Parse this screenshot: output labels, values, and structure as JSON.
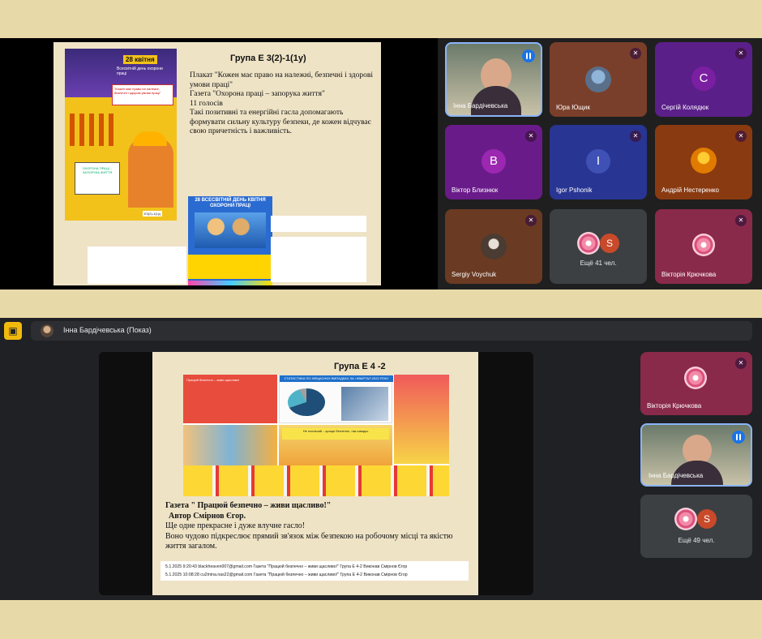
{
  "colors": {
    "accent": "#1a73e8",
    "background": "#e8d9a8",
    "panel": "#202124"
  },
  "screen1": {
    "slide": {
      "title": "Група Е 3(2)-1(1у)",
      "lines": [
        "Плакат \"Кожен має право на належні, безпечні і здорові умови праці\"",
        "Газета \"Охорона праці – запорука життя\"",
        "11 голосів",
        "Такі позитивні та енергійні гасла допомагають формувати сильну культуру безпеки, де кожен відчуває свою причетність і важливість."
      ],
      "poster_left": {
        "date": "28 квітня",
        "subtitle": "Всесвітній день охорони праці",
        "quote": "\"Кожен має право на належні, безпечні і здорові умови праці\"",
        "box": "ОХОРОНА ПРАЦІ – ЗАПОРУКА ЖИТТЯ",
        "code": "Е3(2)-1(1у)"
      },
      "poster_mid": {
        "title": "28 ВСЕСВІТНІЙ ДЕНЬ КВІТНЯ ОХОРОНИ ПРАЦІ"
      }
    },
    "participants": [
      {
        "name": "Інна Бардічевська",
        "kind": "video",
        "speaking": true
      },
      {
        "name": "Юра Ющик",
        "kind": "photo",
        "muted": true
      },
      {
        "name": "Сергій Колядюк",
        "kind": "letter",
        "letter": "C",
        "color": "#7b1fa2",
        "muted": true
      },
      {
        "name": "Віктор Близнюк",
        "kind": "letter",
        "letter": "B",
        "color": "#8e24aa",
        "muted": true
      },
      {
        "name": "Igor Pshonik",
        "kind": "letter",
        "letter": "I",
        "color": "#3949ab",
        "muted": true
      },
      {
        "name": "Андрій Нестеренко",
        "kind": "photo",
        "muted": true
      },
      {
        "name": "Sergiy Voychuk",
        "kind": "photo",
        "muted": true
      },
      {
        "name": "",
        "kind": "more",
        "more_label": "Ещё 41 чел.",
        "letter": "S"
      },
      {
        "name": "Вікторія Крючкова",
        "kind": "flower",
        "muted": true
      }
    ]
  },
  "screen2": {
    "presenter_bar": {
      "title": "Інна Бардічевська (Показ)"
    },
    "slide": {
      "title": "Група Е 4 -2",
      "bold_lines": [
        "Газета \" Працюй безпечно – живи щасливо!\"",
        "Автор Смірнов Єгор."
      ],
      "lines": [
        "Ще одне прекрасне і дуже влучне гасло!",
        "Воно чудово підкреслює прямий зв'язок між безпекою на робочому місці та якістю життя загалом."
      ],
      "table_rows": [
        "5.1.2025 9:20:43  blackheaven007@gmail.com    Газета \"Працюй безпечно – живи щасливо!\" Група Е 4-2 Виконав Смірнов Єгор",
        "5.1.2025 10:08:28  cu2mina.nas22@gmail.com    Газета \"Працюй безпечно – живи щасливо!\" Група Е 4-2 Виконав Смірнов Єгор"
      ],
      "collage_red": "Працюй безпечно – живи щасливо!",
      "collage_stat": "СТАТИСТИКА ПО НЕЩАСНИХ ВИПАДКАХ ЗА І КВАРТАЛ 2022 РОКУ",
      "collage_yellow": "Не поспішай – краще безпечно, ніж швидко"
    },
    "participants": [
      {
        "name": "Вікторія Крючкова",
        "kind": "flower",
        "muted": true
      },
      {
        "name": "Інна Бардічевська",
        "kind": "video",
        "speaking": true
      },
      {
        "name": "",
        "kind": "more",
        "more_label": "Ещё 49 чел.",
        "letter": "S"
      }
    ]
  }
}
